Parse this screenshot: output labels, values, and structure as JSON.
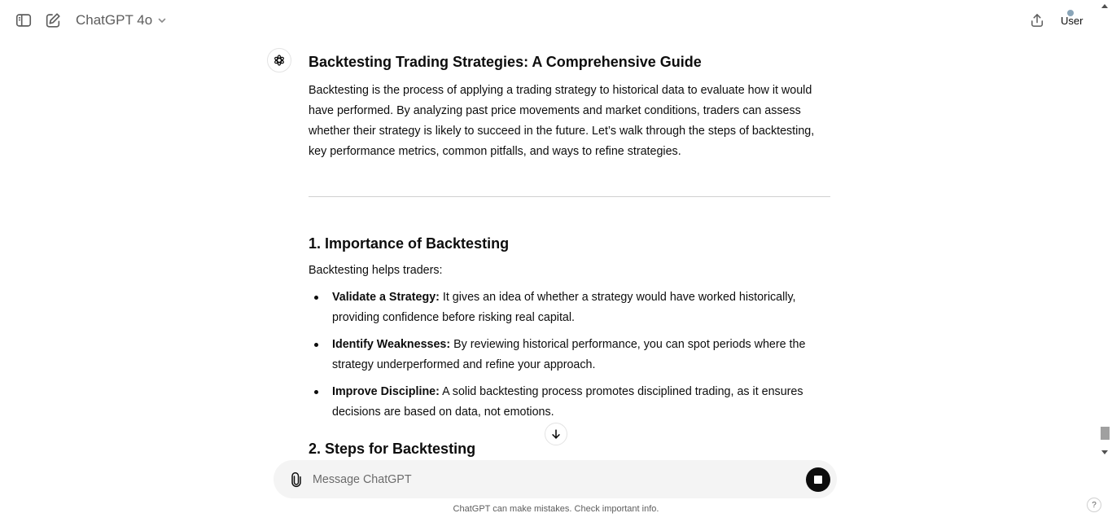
{
  "header": {
    "model_name": "ChatGPT 4o",
    "user_label": "User"
  },
  "icons": {
    "sidebar": "sidebar-toggle-icon",
    "new_chat": "edit-icon",
    "model_dropdown": "chevron-down-icon",
    "share": "share-icon",
    "assistant": "openai-logo-icon",
    "scroll_down": "arrow-down-icon",
    "attach": "paperclip-icon",
    "stop": "stop-icon"
  },
  "article": {
    "title": "Backtesting Trading Strategies: A Comprehensive Guide",
    "intro": "Backtesting is the process of applying a trading strategy to historical data to evaluate how it would have performed. By analyzing past price movements and market conditions, traders can assess whether their strategy is likely to succeed in the future. Let’s walk through the steps of backtesting, key performance metrics, common pitfalls, and ways to refine strategies.",
    "section1": {
      "heading": "1. Importance of Backtesting",
      "lead": "Backtesting helps traders:",
      "points": [
        {
          "term": "Validate a Strategy:",
          "text": " It gives an idea of whether a strategy would have worked historically, providing confidence before risking real capital."
        },
        {
          "term": "Identify Weaknesses:",
          "text": " By reviewing historical performance, you can spot periods where the strategy underperformed and refine your approach."
        },
        {
          "term": "Improve Discipline:",
          "text": " A solid backtesting process promotes disciplined trading, as it ensures decisions are based on data, not emotions."
        }
      ]
    },
    "section2": {
      "heading": "2. Steps for Backtesting"
    }
  },
  "composer": {
    "placeholder": "Message ChatGPT",
    "value": ""
  },
  "footer": {
    "disclaimer": "ChatGPT can make mistakes. Check important info.",
    "help_label": "?"
  },
  "colors": {
    "text": "#0d0d0d",
    "muted": "#5d5d5d",
    "composer_bg": "#f4f4f4",
    "stop_button": "#0d0d0d"
  }
}
